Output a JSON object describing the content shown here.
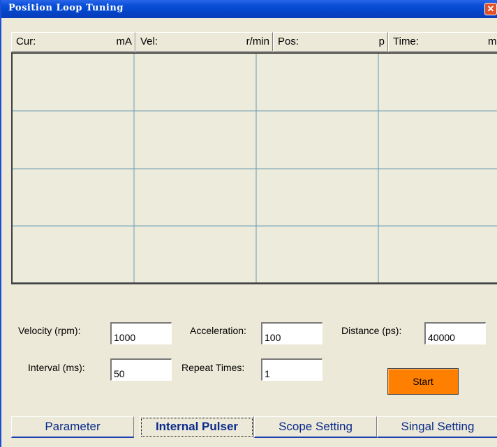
{
  "window": {
    "title": "Position Loop Tuning",
    "close_glyph": "✕"
  },
  "status": {
    "cur_label": "Cur:",
    "cur_unit": "mA",
    "vel_label": "Vel:",
    "vel_unit": "r/min",
    "pos_label": "Pos:",
    "pos_unit": "p",
    "time_label": "Time:",
    "time_unit": "ms"
  },
  "scope": {
    "grid_color": "#6b9bb0",
    "background": "#ecebdc",
    "grid_cols": 4,
    "grid_rows": 4
  },
  "settings": {
    "velocity_label": "Velocity (rpm):",
    "velocity_value": "1000",
    "acceleration_label": "Acceleration:",
    "acceleration_value": "100",
    "distance_label": "Distance (ps):",
    "distance_value": "40000",
    "interval_label": "Interval (ms):",
    "interval_value": "50",
    "repeat_label": "Repeat Times:",
    "repeat_value": "1",
    "start_label": "Start",
    "start_color": "#ff8000"
  },
  "tabs": [
    {
      "label": "Parameter",
      "active": false
    },
    {
      "label": "Internal Pulser",
      "active": true
    },
    {
      "label": "Scope Setting",
      "active": false
    },
    {
      "label": "Singal Setting",
      "active": false
    }
  ],
  "colors": {
    "titlebar": "#0443c6",
    "face": "#ece9d8",
    "tab_text": "#0a2a8c"
  }
}
